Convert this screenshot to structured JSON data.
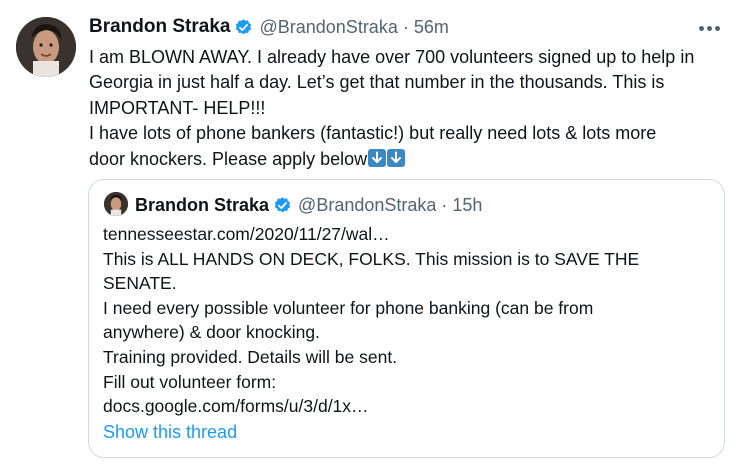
{
  "tweet": {
    "author_name": "Brandon Straka",
    "handle": "@BrandonStraka",
    "separator": "·",
    "time": "56m",
    "more_icon": "more-horizontal-icon",
    "lines": [
      "I am BLOWN AWAY. I already have over 700 volunteers signed up to help in",
      "Georgia in just half a day. Let’s get that number in the thousands. This is",
      "IMPORTANT- HELP!!!",
      "I have lots of phone bankers (fantastic!) but really need lots & lots more",
      "door knockers. Please apply below"
    ],
    "emoji": [
      "⬇️",
      "⬇️"
    ]
  },
  "quoted": {
    "author_name": "Brandon Straka",
    "handle": "@BrandonStraka",
    "separator": "·",
    "time": "15h",
    "lines": [
      "tennesseestar.com/2020/11/27/wal…",
      "This is ALL HANDS ON DECK, FOLKS. This mission is to SAVE THE",
      "SENATE.",
      "I need every possible volunteer for phone banking (can be from",
      "anywhere) & door knocking.",
      "Training provided. Details will be sent.",
      "Fill out volunteer form:",
      "docs.google.com/forms/u/3/d/1x…"
    ],
    "show_thread": "Show this thread"
  },
  "colors": {
    "link": "#1d9bf0",
    "secondary_text": "#536471",
    "border": "#cfd9de",
    "verified": "#1d9bf0"
  }
}
